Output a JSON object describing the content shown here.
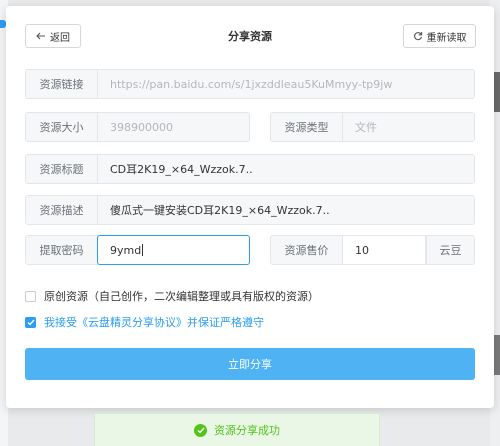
{
  "dialog": {
    "title": "分享资源",
    "back_label": "返回",
    "reload_label": "重新读取"
  },
  "form": {
    "link": {
      "label": "资源链接",
      "value": "https://pan.baidu.com/s/1jxzddleau5KuMmyy-tp9jw"
    },
    "size": {
      "label": "资源大小",
      "value": "398900000"
    },
    "type": {
      "label": "资源类型",
      "value": "文件"
    },
    "title": {
      "label": "资源标题",
      "value": "CD耳2K19_×64_Wzzok.7.."
    },
    "desc": {
      "label": "资源描述",
      "value": "傻瓜式一键安装CD耳2K19_×64_Wzzok.7.."
    },
    "code": {
      "label": "提取密码",
      "value": "9ymd"
    },
    "price": {
      "label": "资源售价",
      "value": "10",
      "unit": "云豆"
    }
  },
  "options": {
    "original_label": "原创资源（自己创作，二次编辑整理或具有版权的资源）",
    "original_checked": false,
    "agree_prefix": "我接受",
    "agree_link": "《云盘精灵分享协议》",
    "agree_suffix": "并保证严格遵守",
    "agree_checked": true
  },
  "submit_label": "立即分享",
  "toast": {
    "message": "资源分享成功"
  },
  "colors": {
    "accent": "#2a9df4",
    "button": "#4fb2f3",
    "success": "#52c41a"
  }
}
